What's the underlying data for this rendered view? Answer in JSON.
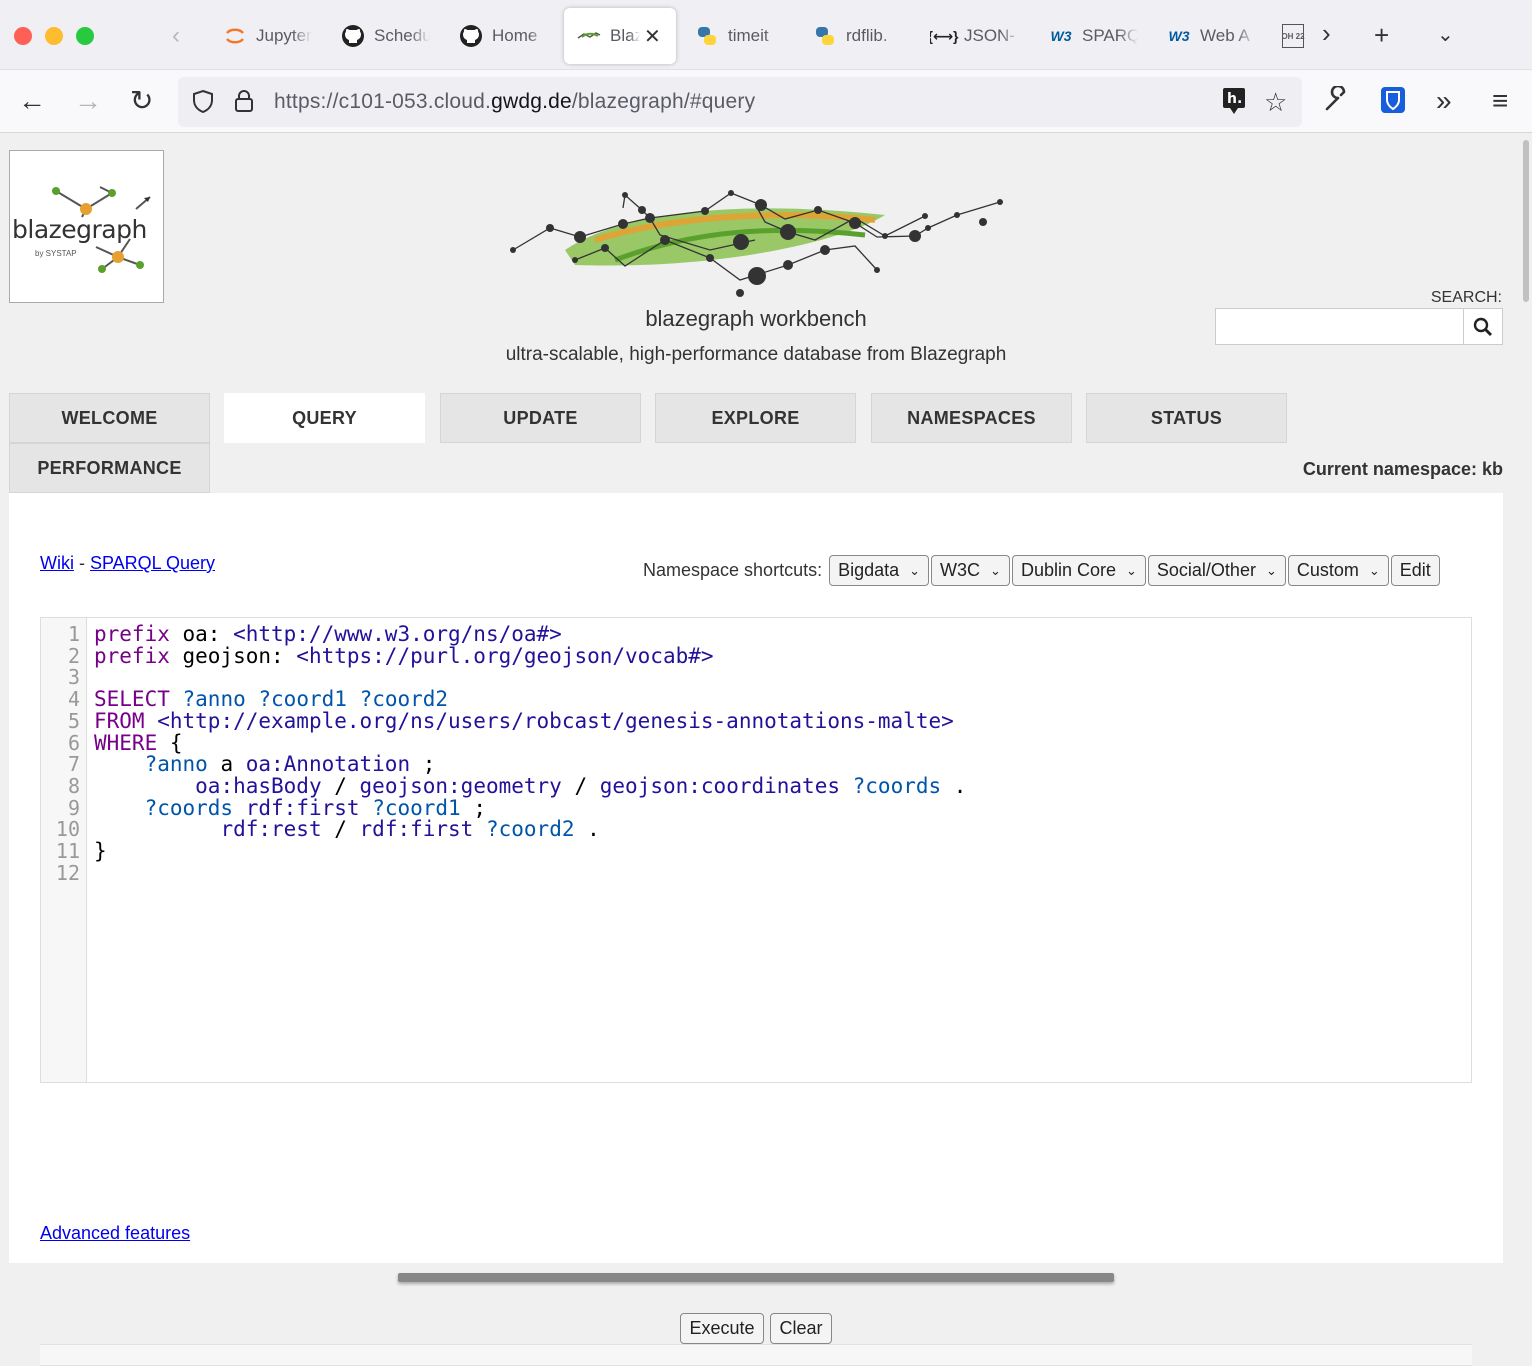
{
  "browser": {
    "tabs": [
      {
        "label": "Jupyter",
        "icon": "jupyter-icon"
      },
      {
        "label": "Schedule",
        "icon": "github-icon"
      },
      {
        "label": "Home",
        "icon": "github-icon"
      },
      {
        "label": "Blazegraph",
        "icon": "blazegraph-icon",
        "active": true
      },
      {
        "label": "timeit",
        "icon": "python-icon"
      },
      {
        "label": "rdflib.",
        "icon": "python-icon"
      },
      {
        "label": "JSON-",
        "icon": "json-icon"
      },
      {
        "label": "SPARQL",
        "icon": "w3c-icon"
      },
      {
        "label": "Web A",
        "icon": "w3c-icon"
      }
    ],
    "url": {
      "prefix": "https://c101-053.cloud.",
      "domain": "gwdg.de",
      "path": "/blazegraph/#query"
    },
    "calendar_icon_text": "OH 22"
  },
  "header": {
    "logo_text": "blazegraph",
    "logo_sub": "by SYSTAP",
    "title": "blazegraph workbench",
    "subtitle": "ultra-scalable, high-performance database from Blazegraph",
    "search_label": "SEARCH:",
    "search_value": ""
  },
  "nav": {
    "tabs": [
      "WELCOME",
      "QUERY",
      "UPDATE",
      "EXPLORE",
      "NAMESPACES",
      "STATUS",
      "PERFORMANCE"
    ],
    "active": "QUERY",
    "current_namespace": "Current namespace: kb"
  },
  "query_panel": {
    "wiki_link": "Wiki",
    "separator": " - ",
    "sparql_link": "SPARQL Query",
    "shortcuts_label": "Namespace shortcuts:",
    "shortcuts": [
      "Bigdata",
      "W3C",
      "Dublin Core",
      "Social/Other",
      "Custom"
    ],
    "edit_label": "Edit",
    "code_lines": [
      "prefix oa: <http://www.w3.org/ns/oa#>",
      "prefix geojson: <https://purl.org/geojson/vocab#>",
      "",
      "SELECT ?anno ?coord1 ?coord2",
      "FROM <http://example.org/ns/users/robcast/genesis-annotations-malte>",
      "WHERE {",
      "    ?anno a oa:Annotation ;",
      "        oa:hasBody / geojson:geometry / geojson:coordinates ?coords .",
      "    ?coords rdf:first ?coord1 ;",
      "          rdf:rest / rdf:first ?coord2 .",
      "}",
      ""
    ],
    "advanced_link": "Advanced features",
    "execute_label": "Execute",
    "clear_label": "Clear"
  },
  "colors": {
    "keyword": "#770088",
    "variable": "#0055aa",
    "iri": "#221199",
    "link": "#0000ee"
  }
}
